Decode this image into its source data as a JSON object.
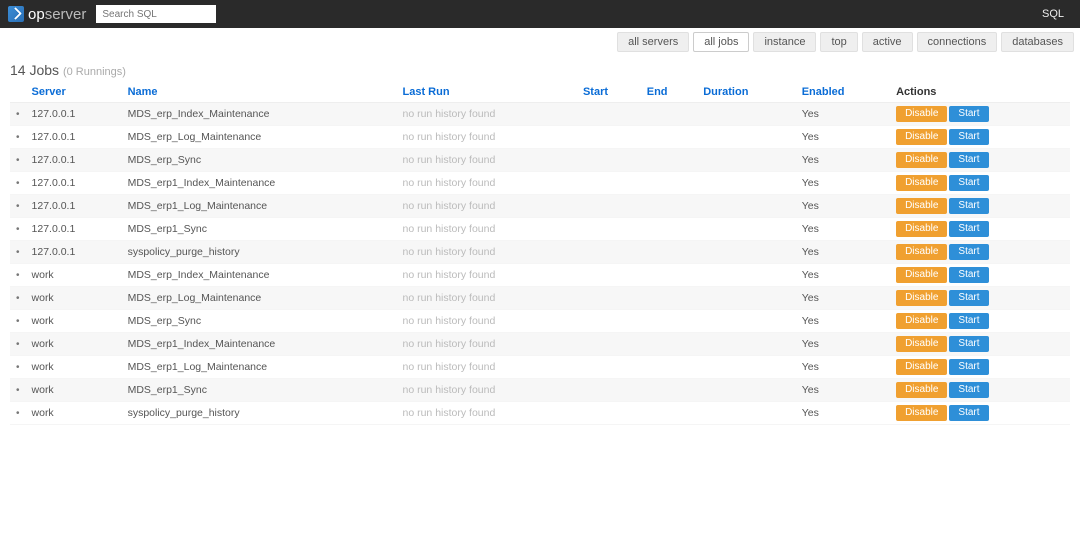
{
  "topbar": {
    "logo_op": "op",
    "logo_server": "server",
    "search_placeholder": "Search SQL",
    "right_label": "SQL"
  },
  "nav": {
    "items": [
      {
        "label": "all servers",
        "active": false
      },
      {
        "label": "all jobs",
        "active": true
      },
      {
        "label": "instance",
        "active": false
      },
      {
        "label": "top",
        "active": false
      },
      {
        "label": "active",
        "active": false
      },
      {
        "label": "connections",
        "active": false
      },
      {
        "label": "databases",
        "active": false
      }
    ]
  },
  "heading": {
    "count": "14",
    "label": "Jobs",
    "sub": "(0 Runnings)"
  },
  "columns": {
    "server": "Server",
    "name": "Name",
    "last_run": "Last Run",
    "start": "Start",
    "end": "End",
    "duration": "Duration",
    "enabled": "Enabled",
    "actions": "Actions"
  },
  "action_labels": {
    "disable": "Disable",
    "start": "Start"
  },
  "no_history": "no run history found",
  "rows": [
    {
      "server": "127.0.0.1",
      "name": "MDS_erp_Index_Maintenance",
      "last_run": "no run history found",
      "enabled": "Yes"
    },
    {
      "server": "127.0.0.1",
      "name": "MDS_erp_Log_Maintenance",
      "last_run": "no run history found",
      "enabled": "Yes"
    },
    {
      "server": "127.0.0.1",
      "name": "MDS_erp_Sync",
      "last_run": "no run history found",
      "enabled": "Yes"
    },
    {
      "server": "127.0.0.1",
      "name": "MDS_erp1_Index_Maintenance",
      "last_run": "no run history found",
      "enabled": "Yes"
    },
    {
      "server": "127.0.0.1",
      "name": "MDS_erp1_Log_Maintenance",
      "last_run": "no run history found",
      "enabled": "Yes"
    },
    {
      "server": "127.0.0.1",
      "name": "MDS_erp1_Sync",
      "last_run": "no run history found",
      "enabled": "Yes"
    },
    {
      "server": "127.0.0.1",
      "name": "syspolicy_purge_history",
      "last_run": "no run history found",
      "enabled": "Yes"
    },
    {
      "server": "work",
      "name": "MDS_erp_Index_Maintenance",
      "last_run": "no run history found",
      "enabled": "Yes"
    },
    {
      "server": "work",
      "name": "MDS_erp_Log_Maintenance",
      "last_run": "no run history found",
      "enabled": "Yes"
    },
    {
      "server": "work",
      "name": "MDS_erp_Sync",
      "last_run": "no run history found",
      "enabled": "Yes"
    },
    {
      "server": "work",
      "name": "MDS_erp1_Index_Maintenance",
      "last_run": "no run history found",
      "enabled": "Yes"
    },
    {
      "server": "work",
      "name": "MDS_erp1_Log_Maintenance",
      "last_run": "no run history found",
      "enabled": "Yes"
    },
    {
      "server": "work",
      "name": "MDS_erp1_Sync",
      "last_run": "no run history found",
      "enabled": "Yes"
    },
    {
      "server": "work",
      "name": "syspolicy_purge_history",
      "last_run": "no run history found",
      "enabled": "Yes"
    }
  ]
}
